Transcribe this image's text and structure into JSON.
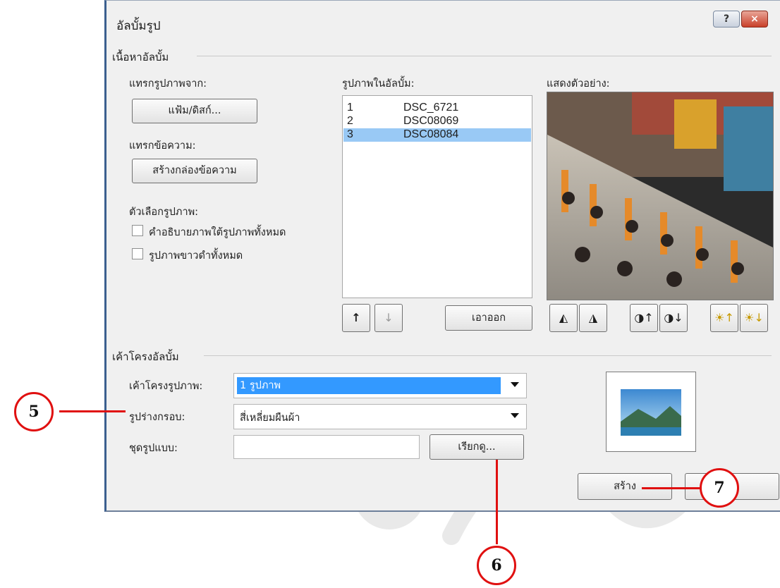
{
  "dialog": {
    "title": "อัลบั้มรูป",
    "help_glyph": "?",
    "close_glyph": "×"
  },
  "content": {
    "section_title": "เนื้อหาอัลบั้ม",
    "insert_picture_label": "แทรกรูปภาพจาก:",
    "file_disk_button": "แฟ้ม/ดิสก์...",
    "insert_text_label": "แทรกข้อความ:",
    "new_textbox_button": "สร้างกล่องข้อความ",
    "picture_options_label": "ตัวเลือกรูปภาพ:",
    "captions_checkbox": "คำอธิบายภาพใต้รูปภาพทั้งหมด",
    "bw_checkbox": "รูปภาพขาวดำทั้งหมด",
    "pictures_label": "รูปภาพในอัลบั้ม:",
    "pictures": [
      {
        "num": "1",
        "name": "DSC_6721"
      },
      {
        "num": "2",
        "name": "DSC08069"
      },
      {
        "num": "3",
        "name": "DSC08084"
      }
    ],
    "selected_index": 3,
    "move_up_glyph": "↑",
    "move_down_glyph": "↓",
    "remove_button": "เอาออก",
    "preview_label": "แสดงตัวอย่าง:"
  },
  "layout_section": {
    "section_title": "เค้าโครงอัลบั้ม",
    "picture_layout_label": "เค้าโครงรูปภาพ:",
    "picture_layout_value": "1 รูปภาพ",
    "frame_shape_label": "รูปร่างกรอบ:",
    "frame_shape_value": "สี่เหลี่ยมผืนผ้า",
    "theme_label": "ชุดรูปแบบ:",
    "theme_value": "",
    "browse_button": "เรียกดู...",
    "create_button": "สร้าง"
  },
  "callouts": [
    "5",
    "6",
    "7"
  ],
  "colors": {
    "accent": "#e01010",
    "selection": "#99c9f5",
    "layout_highlight": "#3399ff"
  }
}
